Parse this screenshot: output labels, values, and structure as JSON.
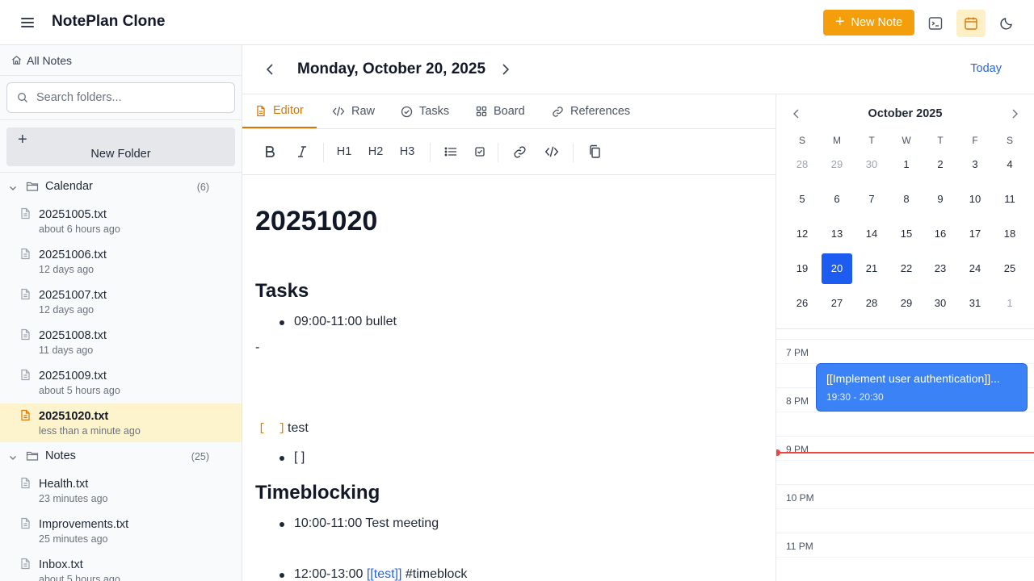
{
  "app": {
    "title": "NotePlan Clone"
  },
  "header": {
    "new_note_label": "New Note"
  },
  "sidebar": {
    "all_notes_label": "All Notes",
    "search_placeholder": "Search folders...",
    "new_folder_label": "New Folder",
    "folders": [
      {
        "name": "Calendar",
        "count": "(6)",
        "files": [
          {
            "name": "20251005.txt",
            "time": "about 6 hours ago"
          },
          {
            "name": "20251006.txt",
            "time": "12 days ago"
          },
          {
            "name": "20251007.txt",
            "time": "12 days ago"
          },
          {
            "name": "20251008.txt",
            "time": "11 days ago"
          },
          {
            "name": "20251009.txt",
            "time": "about 5 hours ago"
          },
          {
            "name": "20251020.txt",
            "time": "less than a minute ago",
            "selected": true
          }
        ]
      },
      {
        "name": "Notes",
        "count": "(25)",
        "files": [
          {
            "name": "Health.txt",
            "time": "23 minutes ago"
          },
          {
            "name": "Improvements.txt",
            "time": "25 minutes ago"
          },
          {
            "name": "Inbox.txt",
            "time": "about 5 hours ago"
          }
        ]
      }
    ]
  },
  "date_header": {
    "title": "Monday, October 20, 2025",
    "today_label": "Today"
  },
  "tabs": [
    {
      "label": "Editor",
      "icon": "file-icon",
      "active": true
    },
    {
      "label": "Raw",
      "icon": "code-icon"
    },
    {
      "label": "Tasks",
      "icon": "check-circle-icon"
    },
    {
      "label": "Board",
      "icon": "grid-icon"
    },
    {
      "label": "References",
      "icon": "link-icon"
    }
  ],
  "toolbar": {
    "h1": "H1",
    "h2": "H2",
    "h3": "H3"
  },
  "document": {
    "title": "20251020",
    "tasks_heading": "Tasks",
    "task_bullet": "09:00-11:00 bullet",
    "dash": "-",
    "checkbox_marker": "[ ]",
    "checkbox_text": "test",
    "empty_checkbox_bullet": "[ ]",
    "timeblocking_heading": "Timeblocking",
    "tb_item1": "10:00-11:00 Test meeting",
    "tb_item2_time": "12:00-13:00",
    "tb_item2_link": "[[test]]",
    "tb_item2_tag": "#timeblock"
  },
  "calendar": {
    "month_title": "October 2025",
    "weekdays": [
      "S",
      "M",
      "T",
      "W",
      "T",
      "F",
      "S"
    ],
    "weeks": [
      [
        "28",
        "29",
        "30",
        "1",
        "2",
        "3",
        "4"
      ],
      [
        "5",
        "6",
        "7",
        "8",
        "9",
        "10",
        "11"
      ],
      [
        "12",
        "13",
        "14",
        "15",
        "16",
        "17",
        "18"
      ],
      [
        "19",
        "20",
        "21",
        "22",
        "23",
        "24",
        "25"
      ],
      [
        "26",
        "27",
        "28",
        "29",
        "30",
        "31",
        "1"
      ]
    ],
    "muted": [
      [
        0,
        0
      ],
      [
        0,
        1
      ],
      [
        0,
        2
      ],
      [
        4,
        6
      ]
    ],
    "selected": [
      3,
      1
    ]
  },
  "timeline": {
    "hours": [
      "7 PM",
      "8 PM",
      "9 PM",
      "10 PM",
      "11 PM"
    ],
    "event": {
      "title": "[[Implement user authentication]]...",
      "time": "19:30 - 20:30"
    }
  },
  "colors": {
    "accent": "#f59e0b",
    "link": "#2563eb",
    "event": "#3b82f6",
    "now_line": "#ef4444"
  }
}
